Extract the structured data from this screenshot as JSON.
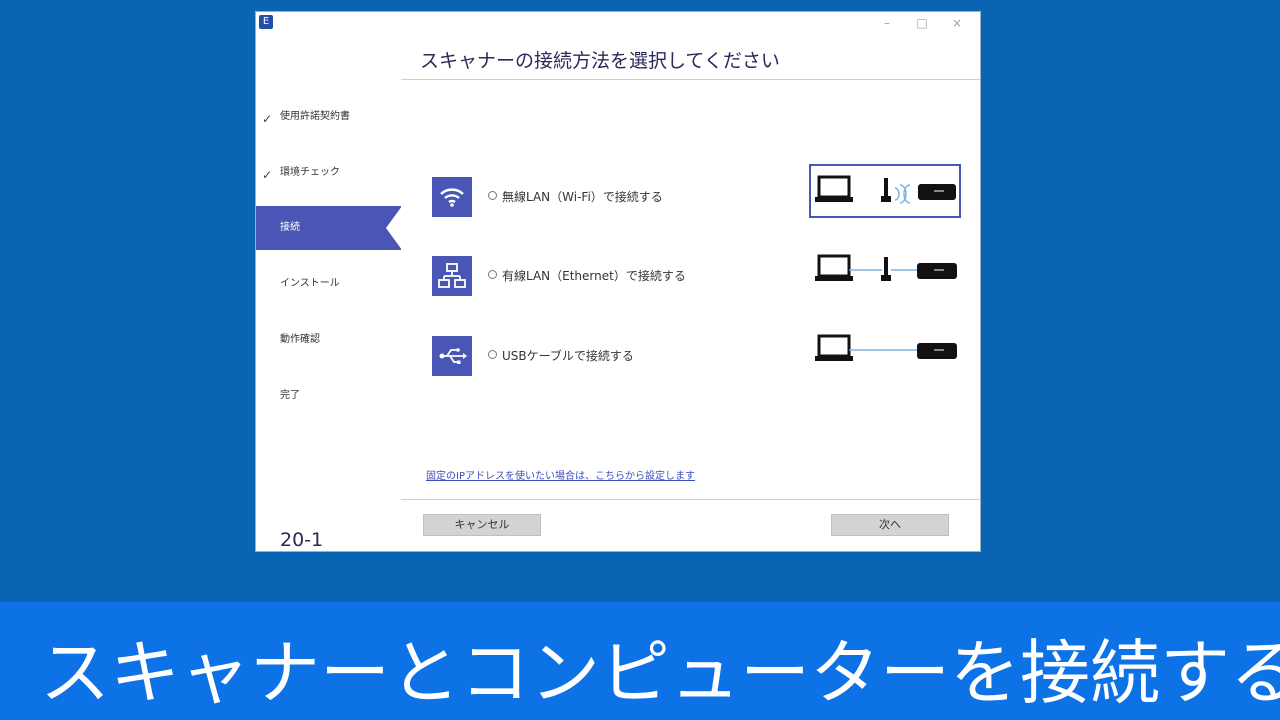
{
  "window": {
    "app_icon_letter": "E",
    "controls": {
      "minimize": "–",
      "maximize": "□",
      "close": "×"
    }
  },
  "sidebar": {
    "steps": [
      {
        "label": "使用許諾契約書",
        "done": true
      },
      {
        "label": "環境チェック",
        "done": true
      },
      {
        "label": "接続",
        "active": true
      },
      {
        "label": "インストール"
      },
      {
        "label": "動作確認"
      },
      {
        "label": "完了"
      }
    ],
    "check_glyph": "✓",
    "version": "20-1"
  },
  "main": {
    "title": "スキャナーの接続方法を選択してください",
    "options": [
      {
        "label": "無線LAN（Wi-Fi）で接続する",
        "icon": "wifi-icon",
        "selected_diagram": true
      },
      {
        "label": "有線LAN（Ethernet）で接続する",
        "icon": "network-icon"
      },
      {
        "label": "USBケーブルで接続する",
        "icon": "usb-icon"
      }
    ],
    "static_ip_link": "固定のIPアドレスを使いたい場合は、こちらから設定します",
    "cancel_label": "キャンセル",
    "next_label": "次へ"
  },
  "caption": "スキャナーとコンピューターを接続する",
  "colors": {
    "background": "#0a64b4",
    "accent": "#4a56b5",
    "caption_bar": "#0d72e6",
    "link": "#3c4fc1"
  }
}
